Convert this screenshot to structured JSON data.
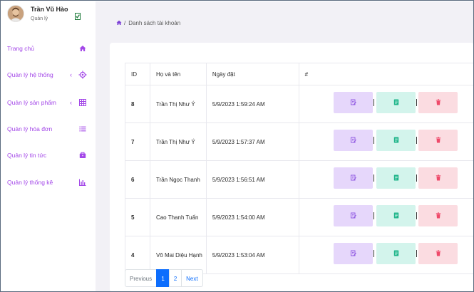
{
  "user": {
    "name": "Trần Vũ Hào",
    "role": "Quản lý"
  },
  "sidebar": {
    "items": [
      {
        "label": "Trang chủ",
        "icon": "home-icon",
        "has_chevron": false
      },
      {
        "label": "Quản lý hệ thống",
        "icon": "target-icon",
        "has_chevron": true
      },
      {
        "label": "Quản lý sản phẩm",
        "icon": "grid-icon",
        "has_chevron": true
      },
      {
        "label": "Quản lý hóa đơn",
        "icon": "list-icon",
        "has_chevron": false
      },
      {
        "label": "Quản lý tin tức",
        "icon": "briefcase-icon",
        "has_chevron": false
      },
      {
        "label": "Quản lý thống kê",
        "icon": "bar-chart-icon",
        "has_chevron": false
      }
    ],
    "chevron": "‹"
  },
  "breadcrumb": {
    "separator": "/",
    "current": "Danh sách tài khoản"
  },
  "table": {
    "headers": [
      "ID",
      "Họ và tên",
      "Ngày đặt",
      "#"
    ],
    "rows": [
      {
        "id": "8",
        "name": "Trần Thị Như Ý",
        "date": "5/9/2023 1:59:24 AM"
      },
      {
        "id": "7",
        "name": "Trần Thị Như Ý",
        "date": "5/9/2023 1:57:37 AM"
      },
      {
        "id": "6",
        "name": "Trần Ngọc Thanh",
        "date": "5/9/2023 1:56:51 AM"
      },
      {
        "id": "5",
        "name": "Cao Thanh Tuấn",
        "date": "5/9/2023 1:54:00 AM"
      },
      {
        "id": "4",
        "name": "Võ Mai Diệu Hạnh",
        "date": "5/9/2023 1:53:04 AM"
      }
    ]
  },
  "pagination": {
    "previous": "Previous",
    "pages": [
      "1",
      "2"
    ],
    "active_page": "1",
    "next": "Next"
  },
  "colors": {
    "accent": "#a347e8",
    "content_bg": "#f2f1f6",
    "edit_button": "#e6d7fb",
    "view_button": "#d3f4ec",
    "delete_button": "#fbdce1",
    "page_active": "#0d6efd"
  }
}
